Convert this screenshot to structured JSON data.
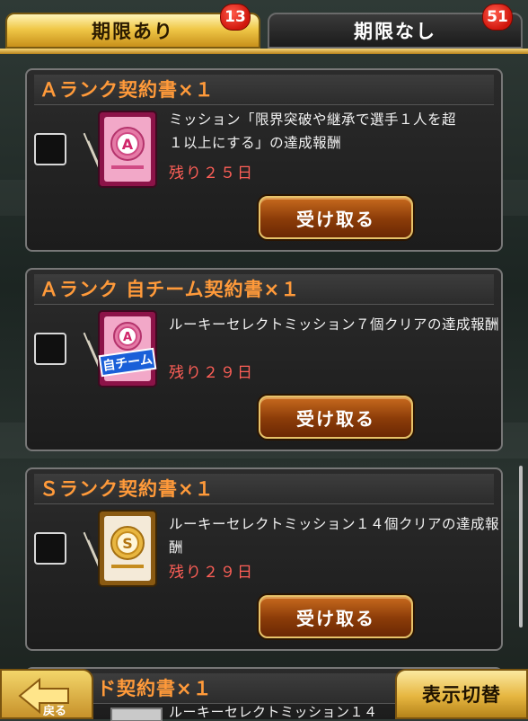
{
  "tabs": {
    "limited": {
      "label": "期限あり",
      "count": "13"
    },
    "unlimited": {
      "label": "期限なし",
      "count": "51"
    }
  },
  "items": [
    {
      "title": "Ａランク契約書×１",
      "icon": "a-rank-contract-icon",
      "description_line1": "ミッション「限界突破や継承で選手１人を超",
      "description_line2": "１以上にする」の達成報酬",
      "remaining": "残り２５日",
      "button": "受け取る"
    },
    {
      "title": "Ａランク 自チーム契約書×１",
      "icon": "a-rank-own-team-contract-icon",
      "icon_label": "自チーム",
      "description_line1": "ルーキーセレクトミッション７個クリアの達成報酬",
      "remaining": "残り２９日",
      "button": "受け取る"
    },
    {
      "title": "Ｓランク契約書×１",
      "icon": "s-rank-contract-icon",
      "description_line1": "ルーキーセレクトミッション１４個クリアの達成報酬",
      "remaining": "残り２９日",
      "button": "受け取る"
    },
    {
      "title": "ド契約書×１",
      "icon": "contract-icon",
      "description_line1": "ルーキーセレクトミッション１４"
    }
  ],
  "footer": {
    "back_label": "戻る",
    "toggle_label": "表示切替"
  },
  "colors": {
    "title_orange": "#ff9a3a",
    "remaining_red": "#ff5f57",
    "badge_red": "#d0160c",
    "tab_gold": "#f0c848"
  }
}
